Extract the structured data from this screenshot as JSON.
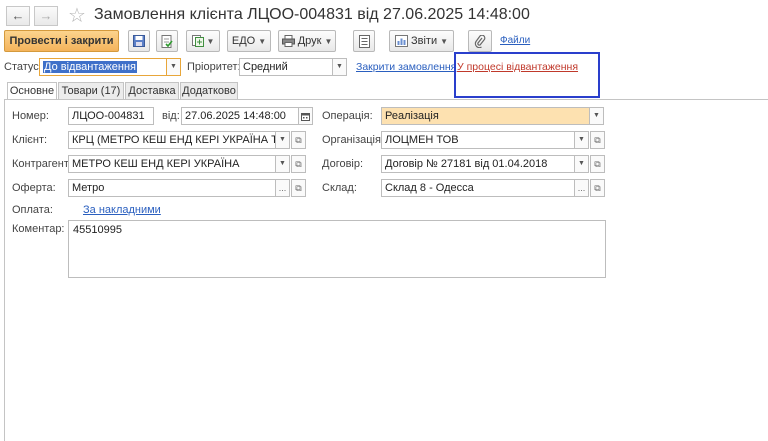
{
  "window": {
    "title": "Замовлення клієнта ЛЦОО-004831 від 27.06.2025 14:48:00"
  },
  "toolbar": {
    "post_close_label": "Провести і закрити",
    "edo_label": "ЕДО",
    "print_label": "Друк",
    "reports_label": "Звіти",
    "files_label": "Файли"
  },
  "status_bar": {
    "status_label": "Статус:",
    "status_value": "До відвантаження",
    "priority_label": "Пріоритет:",
    "priority_value": "Средний",
    "close_order_link": "Закрити замовлення",
    "shipping_link": "У процесі відвантаження"
  },
  "tabs": [
    {
      "label": "Основне"
    },
    {
      "label": "Товари (17)"
    },
    {
      "label": "Доставка"
    },
    {
      "label": "Додатково"
    }
  ],
  "form": {
    "number_label": "Номер:",
    "number_value": "ЛЦОО-004831",
    "date_label": "від:",
    "date_value": "27.06.2025 14:48:00",
    "operation_label": "Операція:",
    "operation_value": "Реалізація",
    "client_label": "Клієнт:",
    "client_value": "КРЦ (МЕТРО КЕШ ЕНД КЕРІ УКРАЇНА ТОВ)",
    "organization_label": "Організація:",
    "organization_value": "ЛОЦМЕН ТОВ",
    "counterparty_label": "Контрагент:",
    "counterparty_value": "МЕТРО КЕШ ЕНД КЕРІ УКРАЇНА",
    "contract_label": "Договір:",
    "contract_value": "Договір № 27181 від 01.04.2018",
    "offer_label": "Оферта:",
    "offer_value": "Метро",
    "warehouse_label": "Склад:",
    "warehouse_value": "Склад 8 - Одесса",
    "payment_label": "Оплата:",
    "payment_link": "За накладними",
    "comment_label": "Коментар:",
    "comment_value": "45510995"
  },
  "colors": {
    "primary_button": "#f4b35b",
    "link": "#2a5fbf",
    "red_link": "#c0392b",
    "highlight_frame": "#2a3fcc",
    "operation_bg": "#fde1b0"
  }
}
